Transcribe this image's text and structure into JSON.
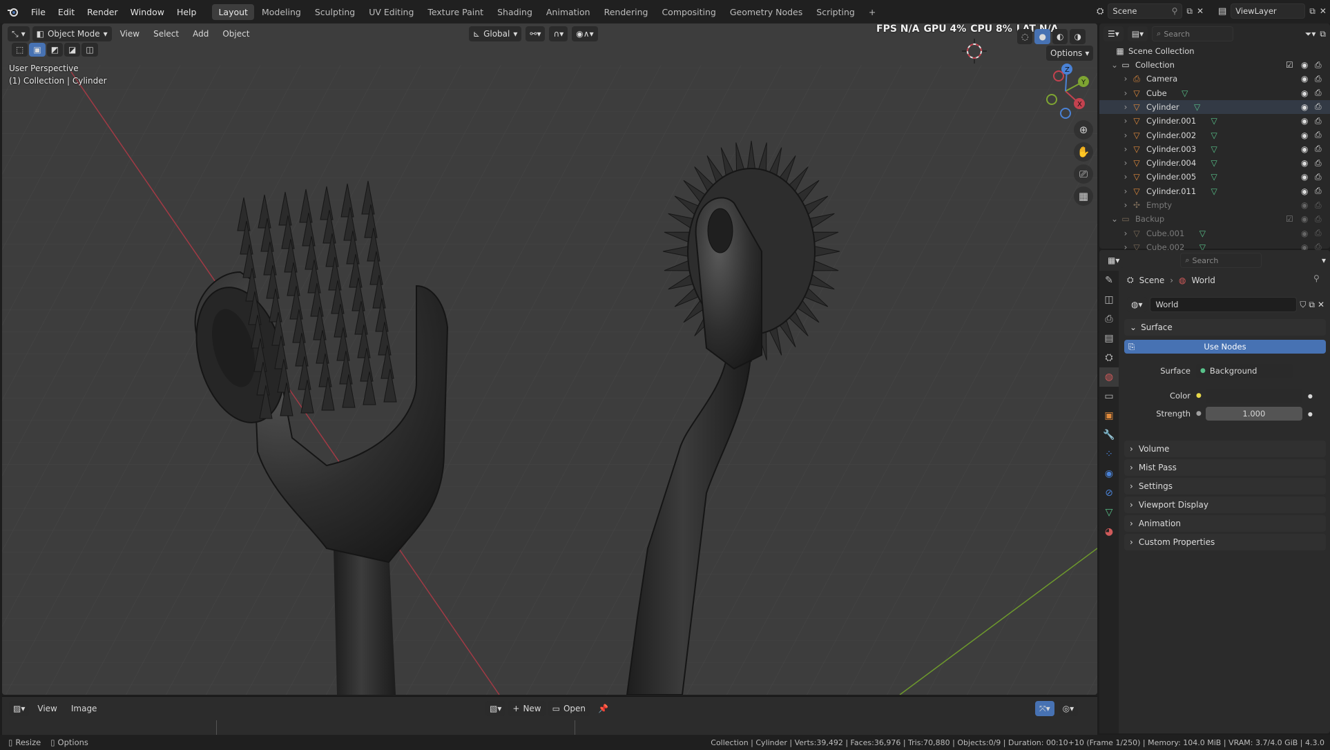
{
  "topbar": {
    "menus": [
      "File",
      "Edit",
      "Render",
      "Window",
      "Help"
    ],
    "workspaces": [
      "Layout",
      "Modeling",
      "Sculpting",
      "UV Editing",
      "Texture Paint",
      "Shading",
      "Animation",
      "Rendering",
      "Compositing",
      "Geometry Nodes",
      "Scripting"
    ],
    "add_workspace": "+",
    "scene": "Scene",
    "view_layer": "ViewLayer"
  },
  "viewport": {
    "mode": "Object Mode",
    "menus": [
      "View",
      "Select",
      "Add",
      "Object"
    ],
    "orientation": "Global",
    "options": "Options",
    "perspective": "User Perspective",
    "context": "(1) Collection | Cylinder",
    "stats": {
      "fps": "FPS N/A",
      "gpu": "GPU 4%",
      "cpu": "CPU 8%",
      "lat": "LAT N/A"
    },
    "gizmo": {
      "x": "X",
      "y": "Y",
      "z": "Z"
    }
  },
  "image_editor": {
    "menus": [
      "View",
      "Image"
    ],
    "new_label": "New",
    "open_label": "Open"
  },
  "statusbar": {
    "left": [
      "Resize",
      "Options"
    ],
    "info": "Collection | Cylinder | Verts:39,492 | Faces:36,976 | Tris:70,880 | Objects:0/9 | Duration: 00:10+10 (Frame 1/250) | Memory: 104.0 MiB | VRAM: 3.7/4.0 GiB | 4.3.0"
  },
  "outliner": {
    "search_placeholder": "Search",
    "scene_collection": "Scene Collection",
    "items": [
      {
        "label": "Collection",
        "kind": "collection",
        "dim": false
      },
      {
        "label": "Camera",
        "kind": "camera",
        "dim": false
      },
      {
        "label": "Cube",
        "kind": "mesh",
        "dim": false
      },
      {
        "label": "Cylinder",
        "kind": "mesh",
        "dim": false
      },
      {
        "label": "Cylinder.001",
        "kind": "mesh",
        "dim": false
      },
      {
        "label": "Cylinder.002",
        "kind": "mesh",
        "dim": false
      },
      {
        "label": "Cylinder.003",
        "kind": "mesh",
        "dim": false
      },
      {
        "label": "Cylinder.004",
        "kind": "mesh",
        "dim": false
      },
      {
        "label": "Cylinder.005",
        "kind": "mesh",
        "dim": false
      },
      {
        "label": "Cylinder.011",
        "kind": "mesh",
        "dim": false
      },
      {
        "label": "Empty",
        "kind": "empty",
        "dim": true
      },
      {
        "label": "Backup",
        "kind": "collection",
        "dim": true
      },
      {
        "label": "Cube.001",
        "kind": "mesh",
        "dim": true
      },
      {
        "label": "Cube.002",
        "kind": "mesh",
        "dim": true
      }
    ]
  },
  "properties": {
    "search_placeholder": "Search",
    "breadcrumb": {
      "scene": "Scene",
      "world": "World"
    },
    "world_name": "World",
    "surface_panel": "Surface",
    "use_nodes": "Use Nodes",
    "surface_label": "Surface",
    "surface_value": "Background",
    "color_label": "Color",
    "strength_label": "Strength",
    "strength_value": "1.000",
    "panels": [
      "Volume",
      "Mist Pass",
      "Settings",
      "Viewport Display",
      "Animation",
      "Custom Properties"
    ]
  },
  "colors": {
    "accent": "#4772b3",
    "x_axis": "#c4424f",
    "y_axis": "#7ea532",
    "z_axis": "#4a82d6",
    "mesh": "#e08a3c"
  }
}
